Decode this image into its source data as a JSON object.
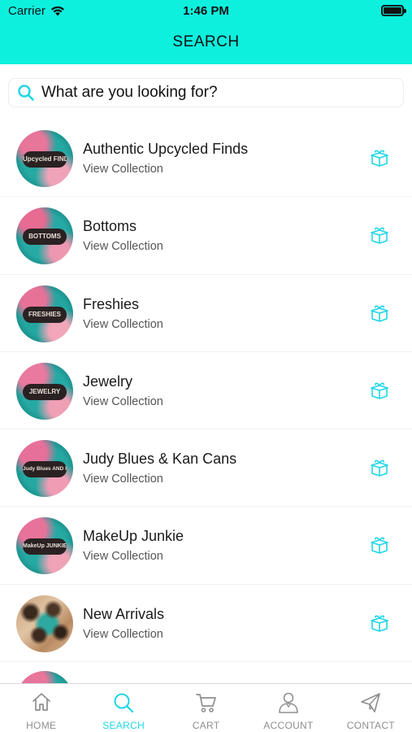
{
  "status_bar": {
    "carrier": "Carrier",
    "time": "1:46 PM"
  },
  "header": {
    "title": "SEARCH"
  },
  "search": {
    "placeholder": "What are you looking for?"
  },
  "collections": [
    {
      "title": "Authentic Upcycled Finds",
      "subtitle": "View Collection",
      "badge": "Upcycled FINDS"
    },
    {
      "title": "Bottoms",
      "subtitle": "View Collection",
      "badge": "BOTTOMS"
    },
    {
      "title": "Freshies",
      "subtitle": "View Collection",
      "badge": "FRESHIES"
    },
    {
      "title": "Jewelry",
      "subtitle": "View Collection",
      "badge": "JEWELRY"
    },
    {
      "title": "Judy Blues & Kan Cans",
      "subtitle": "View Collection",
      "badge": "Judy Blues AND Kan Cans"
    },
    {
      "title": "MakeUp Junkie",
      "subtitle": "View Collection",
      "badge": "MakeUp JUNKIE"
    },
    {
      "title": "New Arrivals",
      "subtitle": "View Collection",
      "badge": ""
    }
  ],
  "tabs": [
    {
      "label": "HOME",
      "icon": "home-icon"
    },
    {
      "label": "SEARCH",
      "icon": "search-icon"
    },
    {
      "label": "CART",
      "icon": "cart-icon"
    },
    {
      "label": "ACCOUNT",
      "icon": "account-icon"
    },
    {
      "label": "CONTACT",
      "icon": "paper-plane-icon"
    }
  ],
  "colors": {
    "header_bg": "#0ef0de",
    "accent": "#1fd6e6",
    "tab_inactive": "#8e8e8e"
  }
}
